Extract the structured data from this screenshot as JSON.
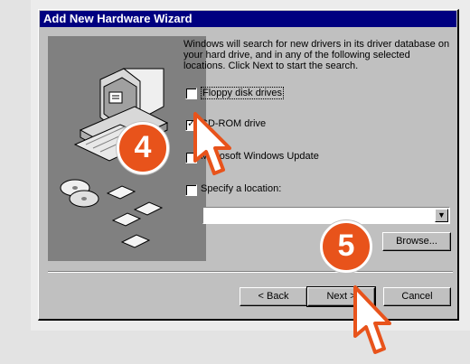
{
  "window": {
    "title": "Add New Hardware Wizard"
  },
  "intro_text": "Windows will search for new drivers in its driver database on your hard drive, and in any of the following selected locations. Click Next to start the search.",
  "options": {
    "floppy": {
      "label": "Floppy disk drives",
      "checked": false
    },
    "cdrom": {
      "label": "CD-ROM drive",
      "checked": true
    },
    "windows_update": {
      "label": "Microsoft Windows Update",
      "checked": false
    },
    "specify": {
      "label": "Specify a location:",
      "checked": false
    }
  },
  "location_combo": {
    "value": ""
  },
  "buttons": {
    "browse": "Browse...",
    "back": "< Back",
    "next": "Next >",
    "cancel": "Cancel"
  },
  "step_badges": {
    "first": "4",
    "second": "5"
  },
  "colors": {
    "title_bar": "#000080",
    "badge": "#e8531b",
    "dialog": "#c0c0c0"
  }
}
